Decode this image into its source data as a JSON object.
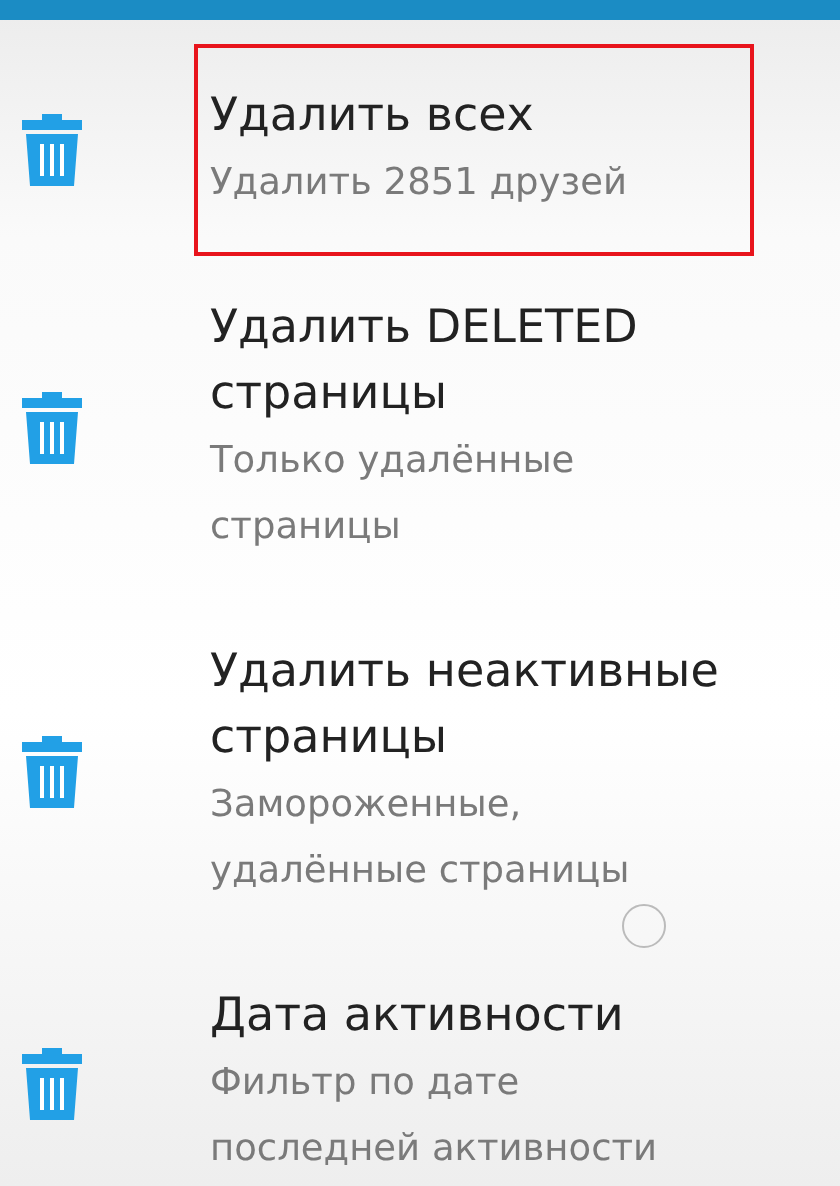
{
  "options": [
    {
      "title": "Удалить всех",
      "subtitle": "Удалить 2851 друзей",
      "highlighted": true
    },
    {
      "title": "Удалить DELETED страницы",
      "subtitle": "Только удалённые страницы",
      "highlighted": false
    },
    {
      "title": "Удалить неактивные страницы",
      "subtitle": "Замороженные, удалённые страницы",
      "highlighted": false
    },
    {
      "title": "Дата активности",
      "subtitle": "Фильтр по дате последней активности",
      "highlighted": false
    }
  ]
}
